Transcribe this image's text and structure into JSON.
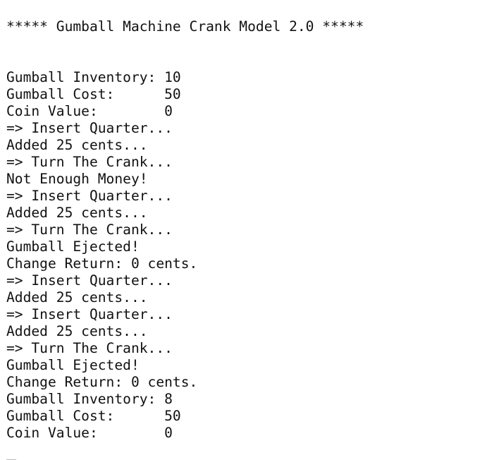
{
  "console": {
    "header": "***** Gumball Machine Crank Model 2.0 *****",
    "lines": [
      "Gumball Inventory: 10",
      "Gumball Cost:      50",
      "Coin Value:        0",
      "=> Insert Quarter...",
      "Added 25 cents...",
      "=> Turn The Crank...",
      "Not Enough Money!",
      "=> Insert Quarter...",
      "Added 25 cents...",
      "=> Turn The Crank...",
      "Gumball Ejected!",
      "Change Return: 0 cents.",
      "=> Insert Quarter...",
      "Added 25 cents...",
      "=> Insert Quarter...",
      "Added 25 cents...",
      "=> Turn The Crank...",
      "Gumball Ejected!",
      "Change Return: 0 cents.",
      "Gumball Inventory: 8",
      "Gumball Cost:      50",
      "Coin Value:        0"
    ]
  }
}
